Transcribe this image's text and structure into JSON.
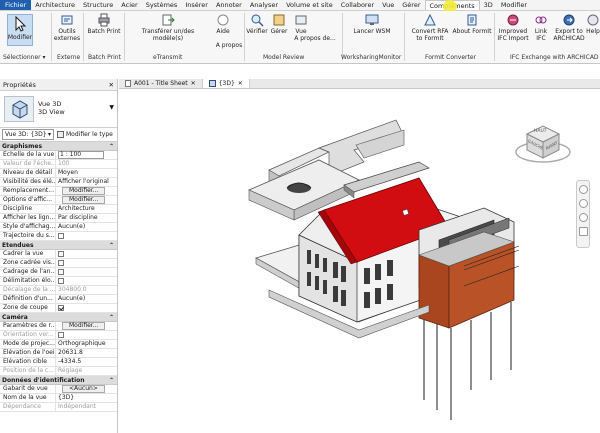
{
  "menubar": {
    "tabs": [
      "Fichier",
      "Architecture",
      "Structure",
      "Acier",
      "Systèmes",
      "Insérer",
      "Annoter",
      "Analyser",
      "Volume et site",
      "Collaborer",
      "Vue",
      "Gérer",
      "Compléments",
      "3D",
      "Modifier"
    ],
    "active": "Compléments"
  },
  "ribbon": {
    "modify": {
      "label": "Modifier",
      "pane": "Sélectionner ▾"
    },
    "external": {
      "label": "Outils externes",
      "pane": "Externe"
    },
    "batch": {
      "label": "Batch Print",
      "pane": "Batch Print"
    },
    "etransmit": {
      "label": "Transférer un/des modèle(s)",
      "pane": "eTransmit"
    },
    "help": {
      "label": "Aide"
    },
    "about1": {
      "label": "A propos"
    },
    "verify": {
      "label": "Vérifier"
    },
    "manage": {
      "label": "Gérer"
    },
    "view": {
      "label": "Vue"
    },
    "about2": {
      "label": "A propos de..."
    },
    "model_review_pane": "Model Review",
    "wsm": {
      "label": "Lancer WSM",
      "pane": "WorksharingMonitor"
    },
    "convert_rfa": {
      "label": "Convert RFA to FormIt"
    },
    "about_formit": {
      "label": "About FormIt"
    },
    "formit_pane": "FormIt Converter",
    "improved_ifc": {
      "label": "Improved IFC Import"
    },
    "link_ifc": {
      "label": "Link IFC"
    },
    "export_archicad": {
      "label": "Export to ARCHICAD"
    },
    "help_short": {
      "label": "Help"
    },
    "ifc_pane": "IFC Exchange with ARCHICAD"
  },
  "properties": {
    "title": "Propriétés",
    "type_name": "Vue 3D",
    "type_sub": "3D View",
    "view_select": "Vue 3D: {3D}",
    "edit_type": "Modifier le type",
    "sections": {
      "graphismes": "Graphismes",
      "etendues": "Etendues",
      "camera": "Caméra",
      "identification": "Données d'identification"
    },
    "graphismes_rows": [
      {
        "label": "Echelle de la vue",
        "value": "1 : 100"
      },
      {
        "label": "Valeur de l'éche...",
        "value": "100"
      },
      {
        "label": "Niveau de détail",
        "value": "Moyen"
      },
      {
        "label": "Visibilité des élé...",
        "value": "Afficher l'original"
      },
      {
        "label": "Remplacement...",
        "value": "Modifier..."
      },
      {
        "label": "Options d'affic...",
        "value": "Modifier..."
      },
      {
        "label": "Discipline",
        "value": "Architecture"
      },
      {
        "label": "Afficher les lign...",
        "value": "Par discipline"
      },
      {
        "label": "Style d'affichag...",
        "value": "Aucun(e)"
      },
      {
        "label": "Trajectoire du s...",
        "value": ""
      }
    ],
    "etendues_rows": [
      {
        "label": "Cadrer la vue",
        "value": ""
      },
      {
        "label": "Zone cadrée vis...",
        "value": ""
      },
      {
        "label": "Cadrage de l'an...",
        "value": ""
      },
      {
        "label": "Délimitation élo...",
        "value": ""
      },
      {
        "label": "Décalage de la ...",
        "value": "304800.0"
      },
      {
        "label": "Définition d'un...",
        "value": "Aucun(e)"
      },
      {
        "label": "Zone de coupe",
        "value": ""
      }
    ],
    "camera_rows": [
      {
        "label": "Paramètres de r...",
        "value": "Modifier..."
      },
      {
        "label": "Orientation ver...",
        "value": ""
      },
      {
        "label": "Mode de projec...",
        "value": "Orthographique"
      },
      {
        "label": "Elévation de l'oeil",
        "value": "20631.8"
      },
      {
        "label": "Elévation cible",
        "value": "-4334.5"
      },
      {
        "label": "Position de la c...",
        "value": "Réglage"
      }
    ],
    "identification_rows": [
      {
        "label": "Gabarit de vue",
        "value": "<Aucun>"
      },
      {
        "label": "Nom de la vue",
        "value": "{3D}"
      },
      {
        "label": "Dépendance",
        "value": "Indépendant"
      }
    ]
  },
  "view_tabs": [
    "A001 - Title Sheet",
    "{3D}"
  ],
  "viewcube": {
    "top": "HAUT",
    "right": "AVANT",
    "left": "GAUCHE"
  },
  "colors": {
    "roof": "#d20d12",
    "cladding": "#a9461f",
    "file_tab": "#1f5fae"
  }
}
